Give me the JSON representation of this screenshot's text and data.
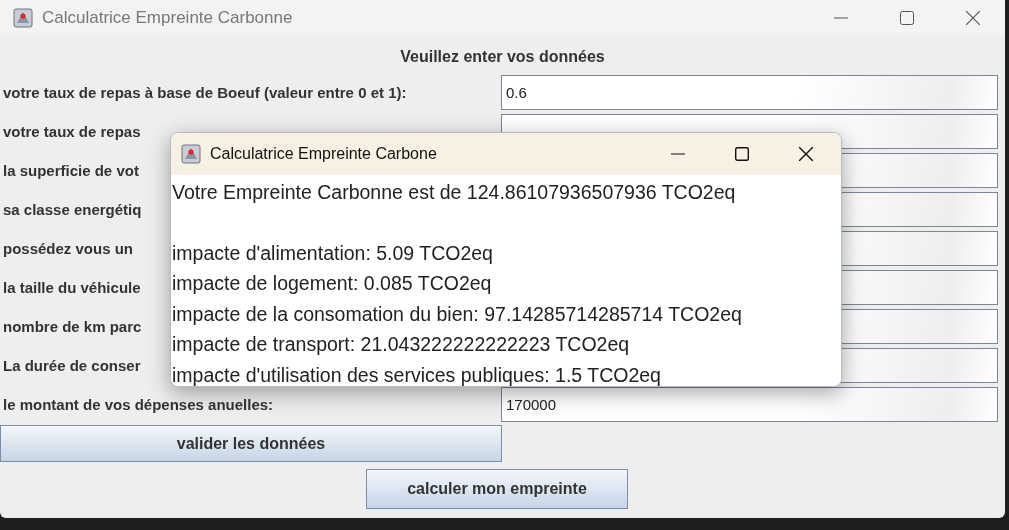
{
  "window": {
    "title": "Calculatrice Empreinte Carbonne"
  },
  "heading": "Veuillez enter vos données",
  "fields": [
    {
      "label": "votre taux de repas à base de Boeuf (valeur entre 0 et 1):",
      "value": "0.6"
    },
    {
      "label": "votre taux de repas"
    },
    {
      "label": "la superficie de vot"
    },
    {
      "label": "sa classe energétiq"
    },
    {
      "label": "possédez vous un"
    },
    {
      "label": "la taille du véhicule"
    },
    {
      "label": "nombre de km parc"
    },
    {
      "label": "La durée de conser"
    },
    {
      "label": "le montant de vos dépenses anuelles:",
      "value": "170000"
    }
  ],
  "validate_button": "valider les données",
  "calculate_button": "calculer mon empreinte",
  "dialog": {
    "title": "Calculatrice Empreinte Carbone",
    "lines": [
      "Votre Empreinte Carbonne est de 124.86107936507936 TCO2eq",
      "impacte d'alimentation: 5.09 TCO2eq",
      "impacte de logement: 0.085 TCO2eq",
      "impacte de la consomation du bien: 97.14285714285714 TCO2eq",
      "impacte de transport: 21.043222222222223 TCO2eq",
      "impacte d'utilisation des services publiques: 1.5 TCO2eq"
    ]
  }
}
